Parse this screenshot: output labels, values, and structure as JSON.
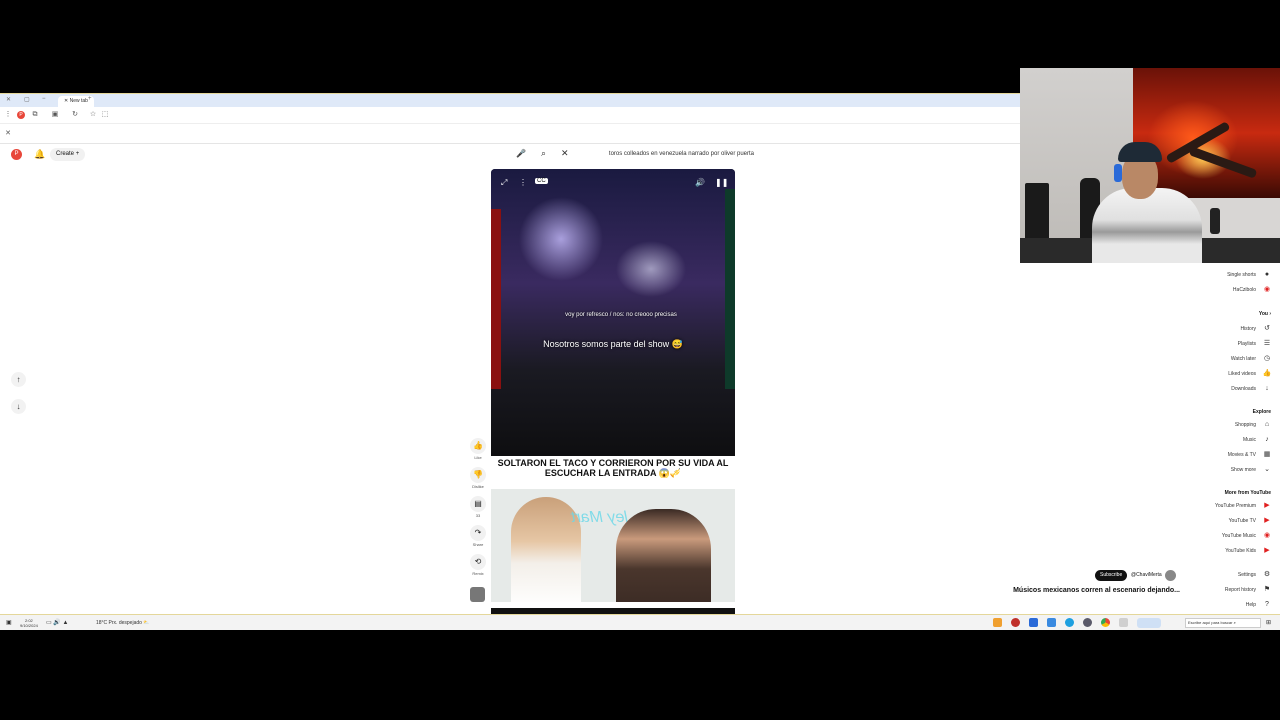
{
  "browser": {
    "tab_title": "New tab",
    "search_query": "toros colleados en venezuela narrado por oliver puerta"
  },
  "header": {
    "create_label": "Create",
    "avatar_letter": "P"
  },
  "shorts": {
    "overlay_small": "voy por refresco / nos: no creooo precisas",
    "overlay_big": "Nosotros somos parte del show 😅",
    "caption": "SOLTARON EL TACO Y CORRIERON POR SU VIDA AL ESCUCHAR LA ENTRADA 😱🎺",
    "actions": [
      {
        "icon": "like-icon",
        "label": "Like"
      },
      {
        "icon": "dislike-icon",
        "label": "Dislike"
      },
      {
        "icon": "comment-icon",
        "label": "33"
      },
      {
        "icon": "share-icon",
        "label": "Share"
      },
      {
        "icon": "remix-icon",
        "label": "Remix"
      }
    ]
  },
  "right_panel": {
    "top_items": [
      "Single shorts",
      "HaCzibolo"
    ],
    "you_title": "You",
    "you_items": [
      "History",
      "Playlists",
      "Watch later",
      "Liked videos",
      "Downloads"
    ],
    "explore_title": "Explore",
    "explore_items": [
      "Shopping",
      "Music",
      "Movies & TV",
      "Show more"
    ],
    "more_title": "More from YouTube",
    "more_items": [
      "YouTube Premium",
      "YouTube TV",
      "YouTube Music",
      "YouTube Kids"
    ],
    "settings_items": [
      "Settings",
      "Report history",
      "Help"
    ],
    "channel_name": "@ChaviMerta",
    "subscribe_label": "Subscribe",
    "short_title": "Músicos mexicanos corren al escenario dejando..."
  },
  "taskbar": {
    "search_placeholder": "Escribe aquí para buscar",
    "weather": "18°C Prx. despejado",
    "clock_time": "2:02",
    "clock_date": "9/10/2024"
  },
  "colors": {
    "accent_red": "#e02020",
    "tab_bg": "#dfe9f8",
    "taskbar_bg": "#f3f3f3"
  }
}
